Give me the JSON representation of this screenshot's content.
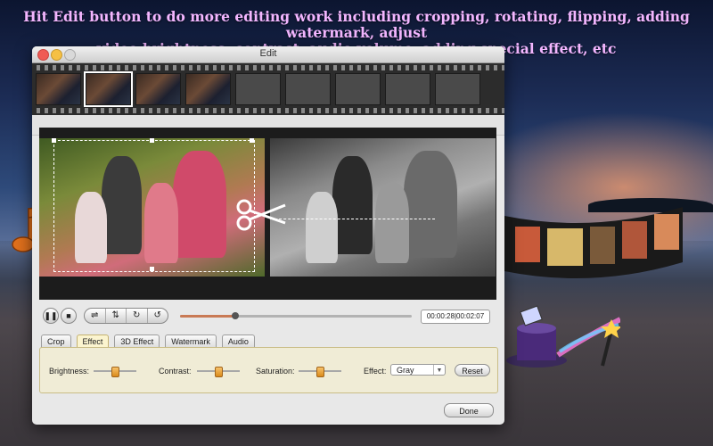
{
  "headline": {
    "line1": "Hit Edit button to do more editing work including cropping, rotating, flipping, adding watermark, adjust",
    "line2": "video brightness, contrast, audio volume, adding special effect, etc"
  },
  "window": {
    "title": "Edit",
    "controls": {
      "close": "close-icon",
      "minimize": "minimize-icon",
      "zoom": "zoom-icon"
    }
  },
  "thumbnails": {
    "count": 9,
    "filled": 4,
    "selected_index": 1
  },
  "playback": {
    "pause_icon": "pause-icon",
    "stop_icon": "stop-icon",
    "tools": [
      "⇌",
      "⇅",
      "↻",
      "↺"
    ],
    "progress": 0.24,
    "time": "00:00:28|00:02:07"
  },
  "tabs": [
    "Crop",
    "Effect",
    "3D Effect",
    "Watermark",
    "Audio"
  ],
  "active_tab": "Effect",
  "effect_panel": {
    "brightness_label": "Brightness:",
    "contrast_label": "Contrast:",
    "saturation_label": "Saturation:",
    "effect_label": "Effect:",
    "effect_value": "Gray",
    "reset_label": "Reset",
    "brightness": 0.5,
    "contrast": 0.5,
    "saturation": 0.5
  },
  "done_label": "Done",
  "colors": {
    "headline": "#f3b6ff",
    "accent": "#c97a55",
    "active_tab": "#fbf4cf"
  }
}
